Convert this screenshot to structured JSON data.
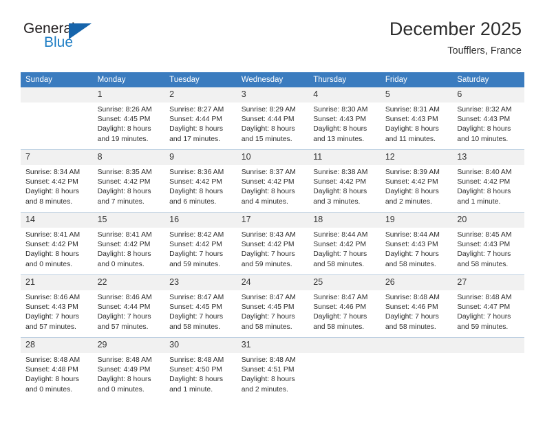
{
  "brand": {
    "name_top": "General",
    "name_bottom": "Blue",
    "accent_color": "#1d7dc4",
    "triangle_color": "#1664ab"
  },
  "header": {
    "title": "December 2025",
    "subtitle": "Toufflers, France"
  },
  "calendar": {
    "header_bg": "#3b7cbf",
    "daynum_bg": "#f1f1f1",
    "weekday_headers": [
      "Sunday",
      "Monday",
      "Tuesday",
      "Wednesday",
      "Thursday",
      "Friday",
      "Saturday"
    ],
    "weeks": [
      [
        {
          "day": "",
          "sunrise": "",
          "sunset": "",
          "daylight": "",
          "empty": true
        },
        {
          "day": "1",
          "sunrise": "Sunrise: 8:26 AM",
          "sunset": "Sunset: 4:45 PM",
          "daylight": "Daylight: 8 hours and 19 minutes."
        },
        {
          "day": "2",
          "sunrise": "Sunrise: 8:27 AM",
          "sunset": "Sunset: 4:44 PM",
          "daylight": "Daylight: 8 hours and 17 minutes."
        },
        {
          "day": "3",
          "sunrise": "Sunrise: 8:29 AM",
          "sunset": "Sunset: 4:44 PM",
          "daylight": "Daylight: 8 hours and 15 minutes."
        },
        {
          "day": "4",
          "sunrise": "Sunrise: 8:30 AM",
          "sunset": "Sunset: 4:43 PM",
          "daylight": "Daylight: 8 hours and 13 minutes."
        },
        {
          "day": "5",
          "sunrise": "Sunrise: 8:31 AM",
          "sunset": "Sunset: 4:43 PM",
          "daylight": "Daylight: 8 hours and 11 minutes."
        },
        {
          "day": "6",
          "sunrise": "Sunrise: 8:32 AM",
          "sunset": "Sunset: 4:43 PM",
          "daylight": "Daylight: 8 hours and 10 minutes."
        }
      ],
      [
        {
          "day": "7",
          "sunrise": "Sunrise: 8:34 AM",
          "sunset": "Sunset: 4:42 PM",
          "daylight": "Daylight: 8 hours and 8 minutes."
        },
        {
          "day": "8",
          "sunrise": "Sunrise: 8:35 AM",
          "sunset": "Sunset: 4:42 PM",
          "daylight": "Daylight: 8 hours and 7 minutes."
        },
        {
          "day": "9",
          "sunrise": "Sunrise: 8:36 AM",
          "sunset": "Sunset: 4:42 PM",
          "daylight": "Daylight: 8 hours and 6 minutes."
        },
        {
          "day": "10",
          "sunrise": "Sunrise: 8:37 AM",
          "sunset": "Sunset: 4:42 PM",
          "daylight": "Daylight: 8 hours and 4 minutes."
        },
        {
          "day": "11",
          "sunrise": "Sunrise: 8:38 AM",
          "sunset": "Sunset: 4:42 PM",
          "daylight": "Daylight: 8 hours and 3 minutes."
        },
        {
          "day": "12",
          "sunrise": "Sunrise: 8:39 AM",
          "sunset": "Sunset: 4:42 PM",
          "daylight": "Daylight: 8 hours and 2 minutes."
        },
        {
          "day": "13",
          "sunrise": "Sunrise: 8:40 AM",
          "sunset": "Sunset: 4:42 PM",
          "daylight": "Daylight: 8 hours and 1 minute."
        }
      ],
      [
        {
          "day": "14",
          "sunrise": "Sunrise: 8:41 AM",
          "sunset": "Sunset: 4:42 PM",
          "daylight": "Daylight: 8 hours and 0 minutes."
        },
        {
          "day": "15",
          "sunrise": "Sunrise: 8:41 AM",
          "sunset": "Sunset: 4:42 PM",
          "daylight": "Daylight: 8 hours and 0 minutes."
        },
        {
          "day": "16",
          "sunrise": "Sunrise: 8:42 AM",
          "sunset": "Sunset: 4:42 PM",
          "daylight": "Daylight: 7 hours and 59 minutes."
        },
        {
          "day": "17",
          "sunrise": "Sunrise: 8:43 AM",
          "sunset": "Sunset: 4:42 PM",
          "daylight": "Daylight: 7 hours and 59 minutes."
        },
        {
          "day": "18",
          "sunrise": "Sunrise: 8:44 AM",
          "sunset": "Sunset: 4:42 PM",
          "daylight": "Daylight: 7 hours and 58 minutes."
        },
        {
          "day": "19",
          "sunrise": "Sunrise: 8:44 AM",
          "sunset": "Sunset: 4:43 PM",
          "daylight": "Daylight: 7 hours and 58 minutes."
        },
        {
          "day": "20",
          "sunrise": "Sunrise: 8:45 AM",
          "sunset": "Sunset: 4:43 PM",
          "daylight": "Daylight: 7 hours and 58 minutes."
        }
      ],
      [
        {
          "day": "21",
          "sunrise": "Sunrise: 8:46 AM",
          "sunset": "Sunset: 4:43 PM",
          "daylight": "Daylight: 7 hours and 57 minutes."
        },
        {
          "day": "22",
          "sunrise": "Sunrise: 8:46 AM",
          "sunset": "Sunset: 4:44 PM",
          "daylight": "Daylight: 7 hours and 57 minutes."
        },
        {
          "day": "23",
          "sunrise": "Sunrise: 8:47 AM",
          "sunset": "Sunset: 4:45 PM",
          "daylight": "Daylight: 7 hours and 58 minutes."
        },
        {
          "day": "24",
          "sunrise": "Sunrise: 8:47 AM",
          "sunset": "Sunset: 4:45 PM",
          "daylight": "Daylight: 7 hours and 58 minutes."
        },
        {
          "day": "25",
          "sunrise": "Sunrise: 8:47 AM",
          "sunset": "Sunset: 4:46 PM",
          "daylight": "Daylight: 7 hours and 58 minutes."
        },
        {
          "day": "26",
          "sunrise": "Sunrise: 8:48 AM",
          "sunset": "Sunset: 4:46 PM",
          "daylight": "Daylight: 7 hours and 58 minutes."
        },
        {
          "day": "27",
          "sunrise": "Sunrise: 8:48 AM",
          "sunset": "Sunset: 4:47 PM",
          "daylight": "Daylight: 7 hours and 59 minutes."
        }
      ],
      [
        {
          "day": "28",
          "sunrise": "Sunrise: 8:48 AM",
          "sunset": "Sunset: 4:48 PM",
          "daylight": "Daylight: 8 hours and 0 minutes."
        },
        {
          "day": "29",
          "sunrise": "Sunrise: 8:48 AM",
          "sunset": "Sunset: 4:49 PM",
          "daylight": "Daylight: 8 hours and 0 minutes."
        },
        {
          "day": "30",
          "sunrise": "Sunrise: 8:48 AM",
          "sunset": "Sunset: 4:50 PM",
          "daylight": "Daylight: 8 hours and 1 minute."
        },
        {
          "day": "31",
          "sunrise": "Sunrise: 8:48 AM",
          "sunset": "Sunset: 4:51 PM",
          "daylight": "Daylight: 8 hours and 2 minutes."
        },
        {
          "day": "",
          "sunrise": "",
          "sunset": "",
          "daylight": "",
          "empty": true
        },
        {
          "day": "",
          "sunrise": "",
          "sunset": "",
          "daylight": "",
          "empty": true
        },
        {
          "day": "",
          "sunrise": "",
          "sunset": "",
          "daylight": "",
          "empty": true
        }
      ]
    ]
  }
}
